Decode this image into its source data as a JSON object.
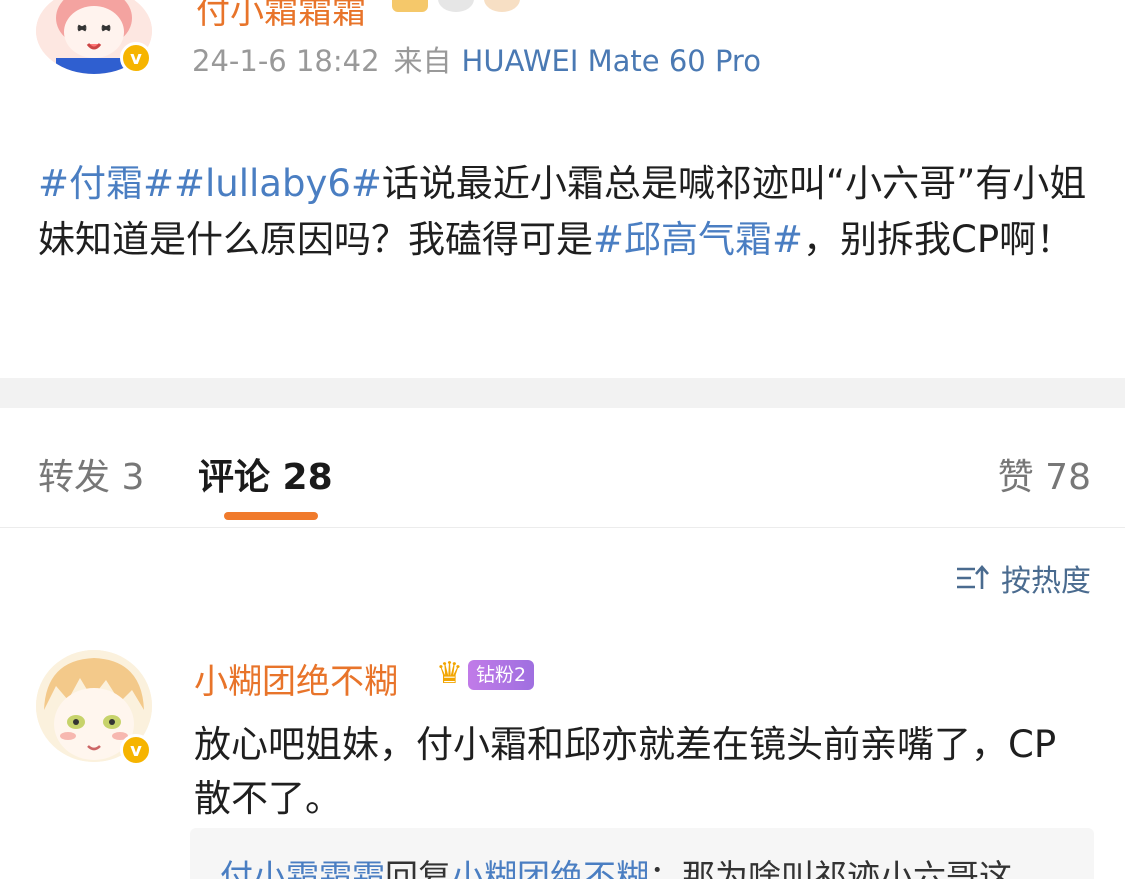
{
  "post": {
    "username": "付小霜霜霜",
    "timestamp": "24-1-6 18:42",
    "from_label": "来自",
    "device": "HUAWEI Mate 60 Pro",
    "body": {
      "tag1": "#付霜#",
      "tag2": "#lullaby6#",
      "text1": "话说最近小霜总是喊祁迹叫“小六哥”有小姐妹知道是什么原因吗？我磕得可是",
      "tag3": "#邱高气霜#",
      "text2": "，别拆我CP啊！"
    }
  },
  "tabs": {
    "repost": "转发 3",
    "comment": "评论 28",
    "like": "赞 78"
  },
  "sort": {
    "label": "按热度",
    "icon": "sort-icon"
  },
  "comment": {
    "username": "小糊团绝不糊",
    "badge": "钻粉2",
    "text": "放心吧姐妹，付小霜和邱亦就差在镜头前亲嘴了，CP散不了。"
  },
  "reply": {
    "author": "付小霜霜霜",
    "verb": "回复",
    "target": "小糊团绝不糊",
    "text": "：那为啥叫祁迹小六哥这"
  },
  "colors": {
    "username": "#e8742a",
    "link": "#4a7ec2",
    "tab_indicator": "#f07a2b",
    "verified": "#f6b400"
  }
}
